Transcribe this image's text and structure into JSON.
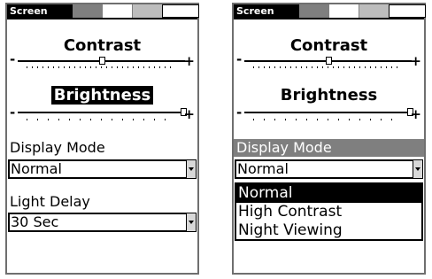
{
  "screens": [
    {
      "title": "Screen",
      "contrast": {
        "label": "Contrast",
        "minus": "-",
        "plus": "+",
        "level": 0.49
      },
      "brightness": {
        "label": "Brightness",
        "minus": "-",
        "plus": "+",
        "level": 0.93
      },
      "display_mode": {
        "label": "Display Mode",
        "value": "Normal"
      },
      "light_delay": {
        "label": "Light Delay",
        "value": "30 Sec"
      }
    },
    {
      "title": "Screen",
      "contrast": {
        "label": "Contrast",
        "minus": "-",
        "plus": "+",
        "level": 0.49
      },
      "brightness": {
        "label": "Brightness",
        "minus": "-",
        "plus": "+",
        "level": 0.93
      },
      "display_mode": {
        "label": "Display Mode",
        "value": "Normal",
        "options": [
          "Normal",
          "High Contrast",
          "Night Viewing"
        ],
        "selected": "Normal"
      }
    }
  ]
}
